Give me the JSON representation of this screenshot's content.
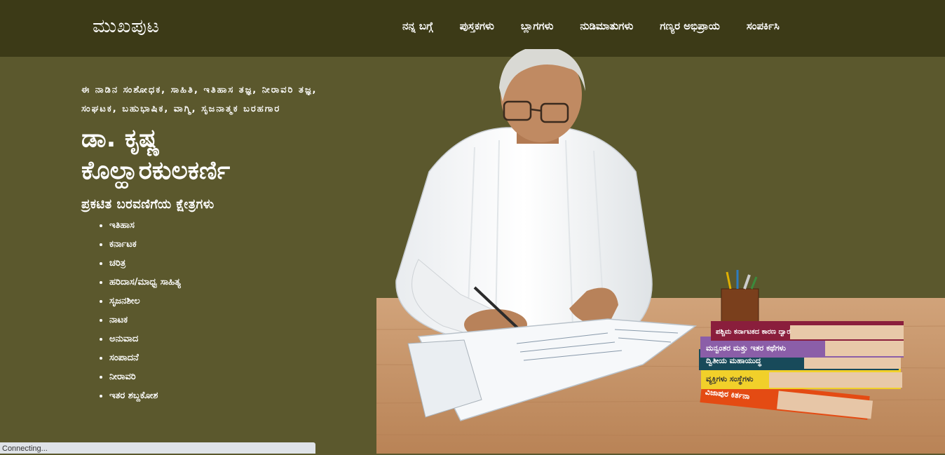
{
  "header": {
    "brand": "ಮುಖಪುಟ",
    "nav": [
      "ನನ್ನ ಬಗ್ಗೆ",
      "ಪುಸ್ತಕಗಳು",
      "ಬ್ಲಾಗಗಳು",
      "ನುಡಿಮಾತುಗಳು",
      "ಗಣ್ಯರ ಅಭಿಪ್ರಾಯ",
      "ಸಂಪರ್ಕಿಸಿ"
    ]
  },
  "intro": {
    "tagline": "ಈ ನಾಡಿನ ಸಂಶೋಧಕ, ಸಾಹಿತಿ, ಇತಿಹಾಸ ತಜ್ಞ, ನೀರಾವರಿ ತಜ್ಞ, ಸಂಘಟಕ, ಬಹುಭಾಷಿಕ, ವಾಗ್ಮಿ, ಸೃಜನಾತ್ಮಕ ಬರಹಗಾರ",
    "name_line1": "ಡಾ. ಕೃಷ್ಣ",
    "name_line2": "ಕೊಲ್ಹಾರಕುಲಕರ್ಣಿ",
    "fields_title": "ಪ್ರಕಟಿತ ಬರವಣಿಗೆಯ ಕ್ಷೇತ್ರಗಳು",
    "fields": [
      "ಇತಿಹಾಸ",
      "ಕರ್ನಾಟಕ",
      "ಚರಿತ್ರ",
      "ಹರಿದಾಸ/ಮಾಧ್ವ ಸಾಹಿತ್ಯ",
      "ಸೃಜನಶೀಲ",
      "ನಾಟಕ",
      "ಅನುವಾದ",
      "ಸಂಪಾದನೆ",
      "ನೀರಾವರಿ",
      "ಇತರ ಶಬ್ದಕೋಶ"
    ]
  },
  "books": [
    "ಪಶ್ಚಿಮ ಕರ್ನಾಟಕದ ಕಾರಣ ದ್ವಾರ",
    "ಮನ್ವಂತರ ಮತ್ತು ಇತರ ಕಥೆಗಳು",
    "ದ್ವಿತೀಯ ಮಹಾಯುದ್ಧ",
    "ವ್ಯಕ್ತಿಗಳು ಸಂಸ್ಥೆಗಳು",
    "ವಿಜಾಪುರ ಕಿರ್ತನಾ"
  ],
  "status": {
    "text": "Connecting..."
  },
  "colors": {
    "navbar": "#3c3a17",
    "background": "#5b582d",
    "table": "#c9996f"
  }
}
